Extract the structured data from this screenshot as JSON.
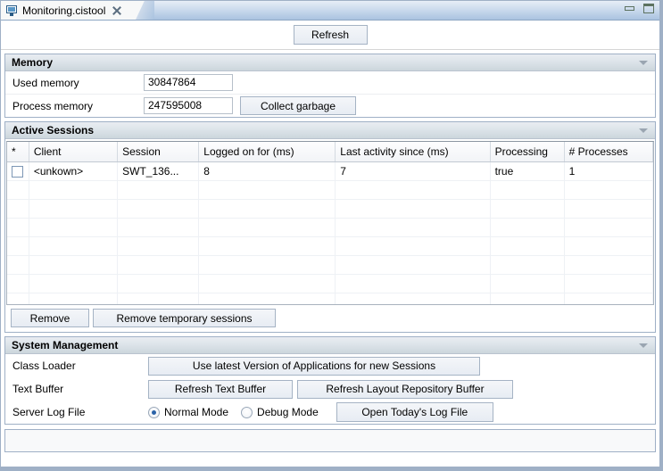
{
  "window": {
    "minimize_icon": "minimize-icon",
    "maximize_icon": "maximize-icon"
  },
  "tab": {
    "icon": "monitor-icon",
    "title": "Monitoring.cistool",
    "close_icon": "close-icon"
  },
  "toolbar": {
    "refresh_label": "Refresh"
  },
  "memory": {
    "title": "Memory",
    "collapse_icon": "chevron-down-icon",
    "used_label": "Used memory",
    "used_value": "30847864",
    "process_label": "Process memory",
    "process_value": "247595008",
    "collect_label": "Collect garbage"
  },
  "sessions": {
    "title": "Active Sessions",
    "collapse_icon": "chevron-down-icon",
    "columns": [
      "*",
      "Client",
      "Session",
      "Logged on for (ms)",
      "Last activity since (ms)",
      "Processing",
      "# Processes"
    ],
    "rows": [
      {
        "selected": false,
        "client": "<unkown>",
        "session": "SWT_136...",
        "logged_on_for": "8",
        "last_activity_since": "7",
        "processing": "true",
        "processes": "1"
      }
    ],
    "remove_label": "Remove",
    "remove_temp_label": "Remove temporary sessions"
  },
  "system_management": {
    "title": "System Management",
    "collapse_icon": "chevron-down-icon",
    "class_loader_label": "Class Loader",
    "use_latest_label": "Use latest Version of Applications for new Sessions",
    "text_buffer_label": "Text Buffer",
    "refresh_text_buffer_label": "Refresh Text Buffer",
    "refresh_layout_label": "Refresh Layout Repository Buffer",
    "server_log_label": "Server Log File",
    "normal_mode_label": "Normal Mode",
    "debug_mode_label": "Debug Mode",
    "selected_mode": "Normal Mode",
    "open_log_label": "Open Today's Log File"
  },
  "colors": {
    "accent": "#2b63a8",
    "section_border": "#9fb0c6",
    "tab_gradient_top": "#e7eef7",
    "tab_gradient_bottom": "#aac3e0"
  }
}
